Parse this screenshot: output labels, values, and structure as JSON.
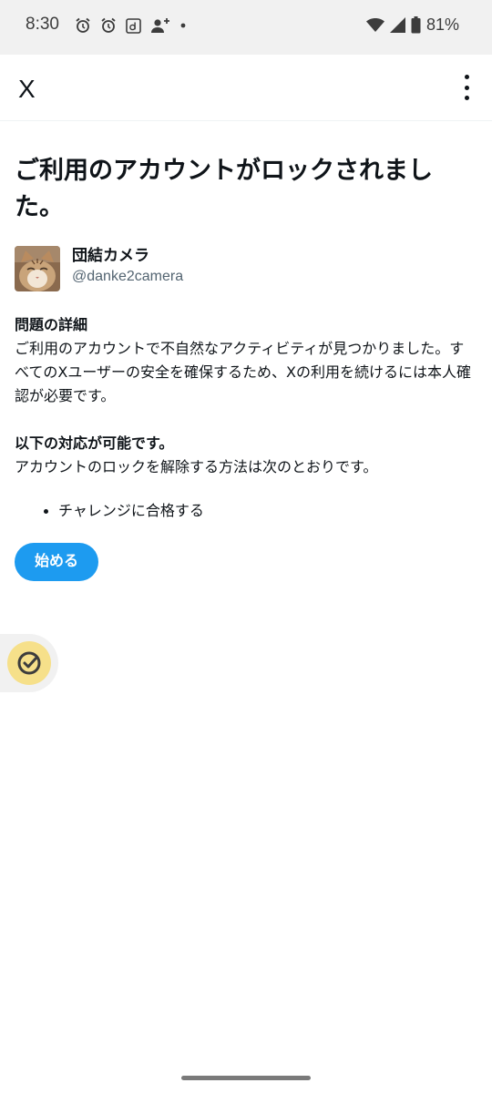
{
  "status_bar": {
    "time": "8:30",
    "battery": "81%",
    "left_icons": [
      "alarm-icon",
      "alarm-icon",
      "d-app-icon",
      "person-add-icon",
      "dot-icon"
    ],
    "right_icons": [
      "wifi-icon",
      "signal-icon",
      "battery-icon"
    ]
  },
  "app_bar": {
    "logo": "X",
    "menu_icon": "more-vert-icon"
  },
  "main": {
    "title": "ご利用のアカウントがロックされました。",
    "account": {
      "display_name": "団結カメラ",
      "handle": "@danke2camera",
      "avatar": "cat-avatar"
    },
    "details_heading": "問題の詳細",
    "details_body": "ご利用のアカウントで不自然なアクティビティが見つかりました。すべてのXユーザーの安全を確保するため、Xの利用を続けるには本人確認が必要です。",
    "options_heading": "以下の対応が可能です。",
    "options_body": "アカウントのロックを解除する方法は次のとおりです。",
    "options": [
      "チャレンジに合格する"
    ],
    "start_button": "始める"
  },
  "floating": {
    "icon": "check-circle-icon"
  },
  "colors": {
    "accent": "#1d9bf0",
    "text": "#0f1419",
    "secondary_text": "#536471",
    "fab_background": "#f6e08a"
  }
}
